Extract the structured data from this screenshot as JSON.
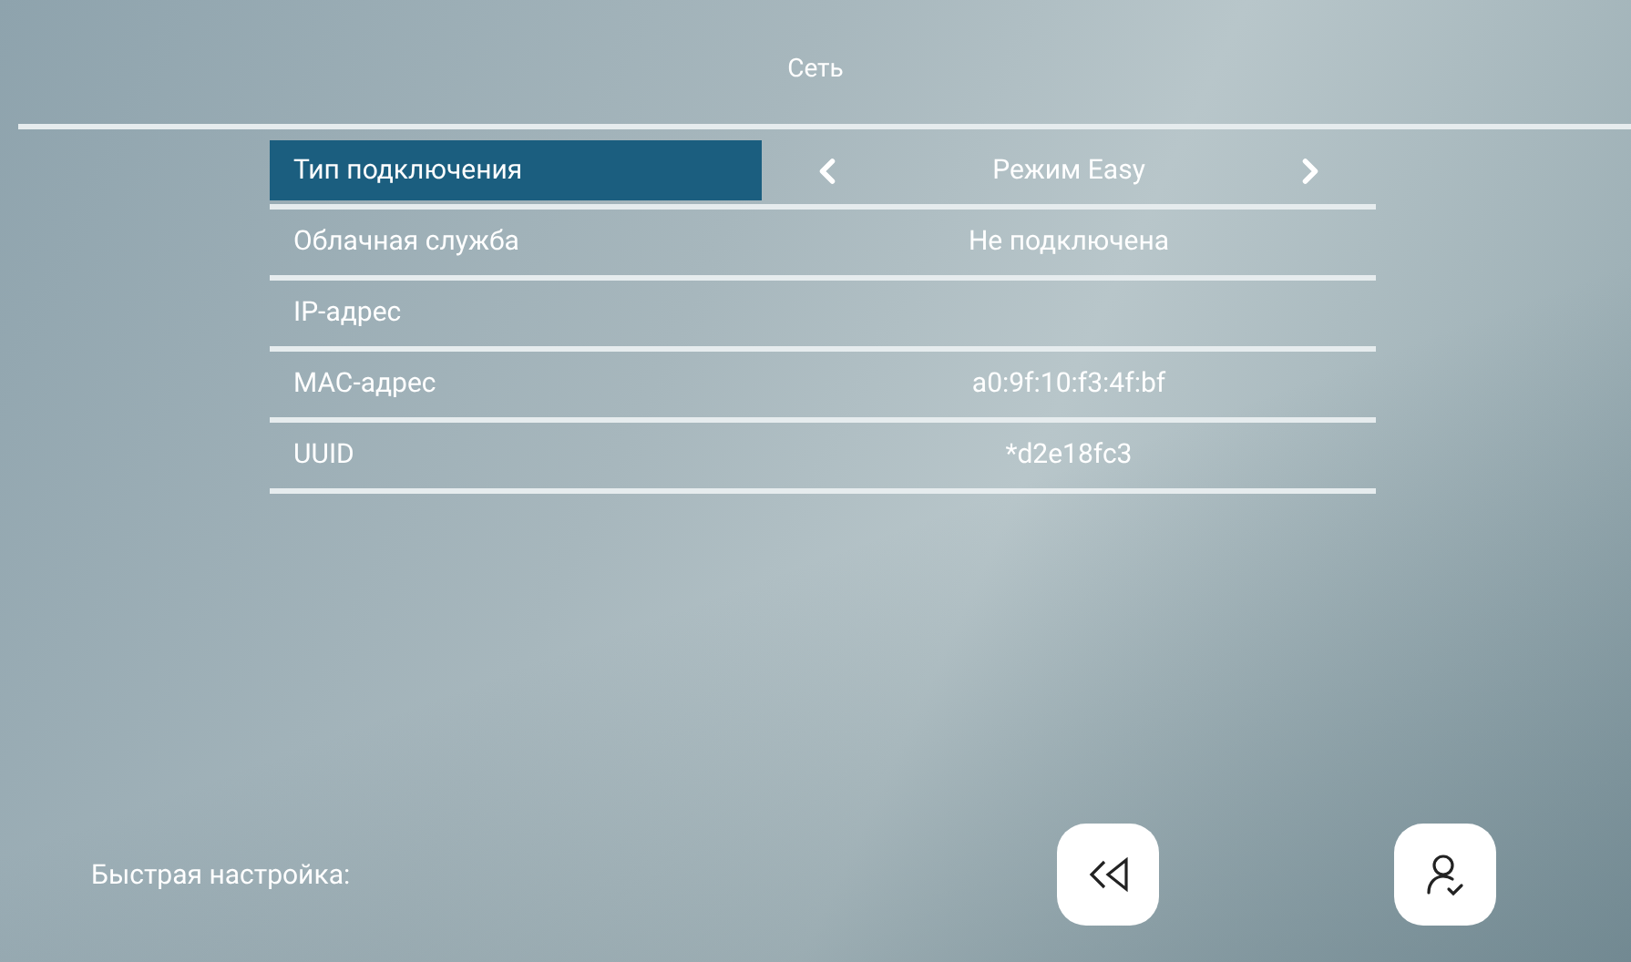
{
  "title": "Сеть",
  "rows": [
    {
      "label": "Тип подключения",
      "value": "Режим Easy",
      "selected": true,
      "kind": "selector"
    },
    {
      "label": "Облачная служба",
      "value": "Не подключена",
      "selected": false,
      "kind": "info"
    },
    {
      "label": "IP-адрес",
      "selected": false,
      "kind": "info"
    },
    {
      "label": "MAC-адрес",
      "value": "a0:9f:10:f3:4f:bf",
      "selected": false,
      "kind": "info"
    },
    {
      "label": "UUID",
      "value": "*d2e18fc3",
      "selected": false,
      "kind": "info"
    }
  ],
  "quick_setup": {
    "label": "Быстрая настройка:"
  }
}
